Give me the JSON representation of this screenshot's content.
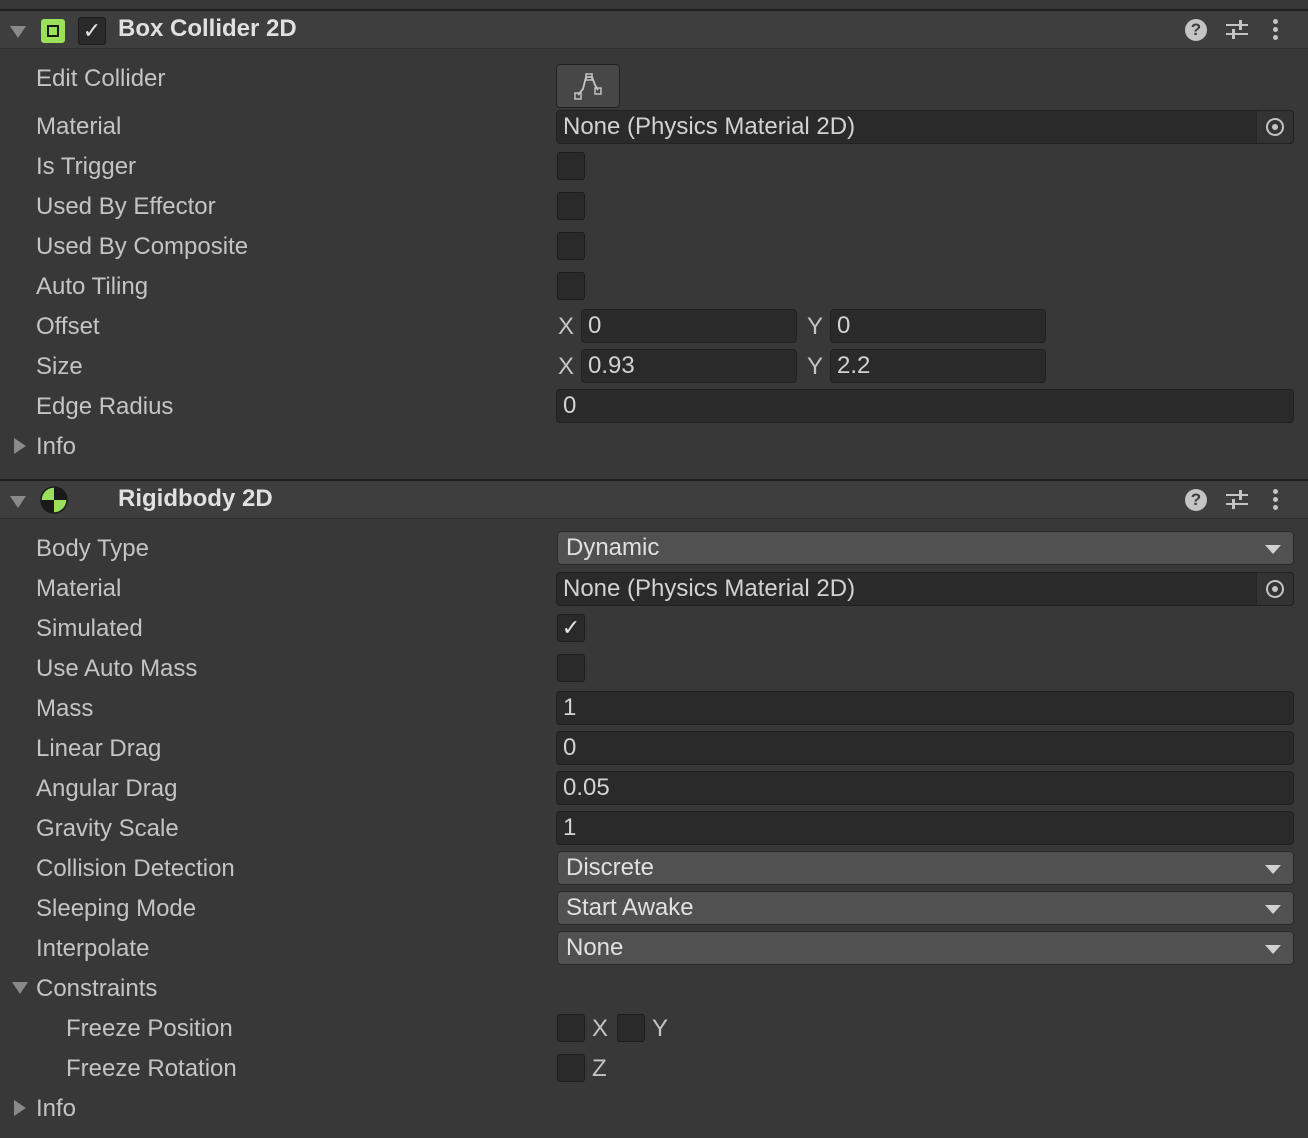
{
  "box_collider": {
    "title": "Box Collider 2D",
    "enabled_mark": "✓",
    "edit_collider_label": "Edit Collider",
    "material_label": "Material",
    "material_value": "None (Physics Material 2D)",
    "is_trigger_label": "Is Trigger",
    "used_by_effector_label": "Used By Effector",
    "used_by_composite_label": "Used By Composite",
    "auto_tiling_label": "Auto Tiling",
    "offset_label": "Offset",
    "offset_x": "0",
    "offset_y": "0",
    "size_label": "Size",
    "size_x": "0.93",
    "size_y": "2.2",
    "edge_radius_label": "Edge Radius",
    "edge_radius_value": "0",
    "info_label": "Info",
    "axis_x": "X",
    "axis_y": "Y"
  },
  "rigidbody": {
    "title": "Rigidbody 2D",
    "body_type_label": "Body Type",
    "body_type_value": "Dynamic",
    "material_label": "Material",
    "material_value": "None (Physics Material 2D)",
    "simulated_label": "Simulated",
    "simulated_mark": "✓",
    "use_auto_mass_label": "Use Auto Mass",
    "mass_label": "Mass",
    "mass_value": "1",
    "linear_drag_label": "Linear Drag",
    "linear_drag_value": "0",
    "angular_drag_label": "Angular Drag",
    "angular_drag_value": "0.05",
    "gravity_scale_label": "Gravity Scale",
    "gravity_scale_value": "1",
    "collision_detection_label": "Collision Detection",
    "collision_detection_value": "Discrete",
    "sleeping_mode_label": "Sleeping Mode",
    "sleeping_mode_value": "Start Awake",
    "interpolate_label": "Interpolate",
    "interpolate_value": "None",
    "constraints_label": "Constraints",
    "freeze_position_label": "Freeze Position",
    "freeze_rotation_label": "Freeze Rotation",
    "axis_x": "X",
    "axis_y": "Y",
    "axis_z": "Z",
    "info_label": "Info"
  },
  "header_icons": {
    "help": "?",
    "help_icon": "help-icon",
    "presets_icon": "sliders-icon",
    "menu_icon": "kebab-menu-icon"
  },
  "colors": {
    "accent_green": "#9be05a",
    "background": "#383838",
    "field": "#2a2a2a",
    "dropdown": "#515151"
  }
}
